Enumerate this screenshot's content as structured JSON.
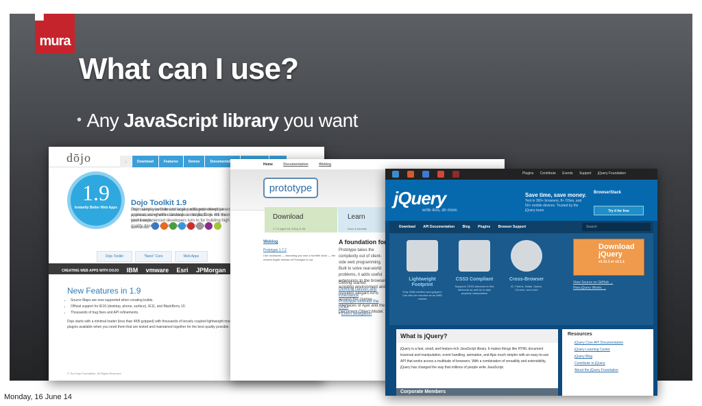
{
  "slide": {
    "logo_text": "mura",
    "title": "What can I use?",
    "bullet_prefix": "Any ",
    "bullet_bold": "JavaScript library",
    "bullet_suffix": " you want"
  },
  "footer": {
    "date": "Monday, 16 June 14"
  },
  "dojo": {
    "brand": "dōjo",
    "nav": [
      "Download",
      "Features",
      "Demos",
      "Documentation",
      "Community",
      "Blog"
    ],
    "badge_num": "1.9",
    "badge_sub": "Instantly Better Web Apps",
    "headline": "Dojo Toolkit 1.9",
    "intro": "Dojo saves you time and scales with your development process, using web standards as its platform. It's the toolkit experienced developers turn to for building high quality desktop and mobile web applications.",
    "intro2": "From simple websites to large packaged enterprise applications whether desktop or mobile, Dojo will meet your needs.",
    "supporting": "SUPPORTING",
    "tabs": [
      "Dojo Toolkit",
      "\"Nano\" Core",
      "Web Apps"
    ],
    "partners_label": "CREATING WEB APPS WITH DOJO",
    "partners": [
      "IBM",
      "vmware",
      "Esri",
      "JPMorgan",
      "cisco"
    ],
    "new_title": "New Features in 1.9",
    "features": [
      "Source Maps are now supported when creating builds.",
      "Official support for IE10 (desktop, phone, surface), IE11, and BlackBerry 10.",
      "Thousands of bug fixes and API refinements."
    ],
    "para": "Dojo starts with a minimal loader (less than 4KB gzipped) with thousands of loosely coupled lightweight modules and plugins available when you need them that are tested and maintained together for the best quality possible.",
    "foot": "© The Dojo Foundation, All Rights Reserved."
  },
  "prototype": {
    "nav": [
      "Home",
      "Documentation",
      "Weblog"
    ],
    "logo": "prototype",
    "download": "Download",
    "download_sub": "1.7.2 (April 18, 2014) & Git",
    "learn": "Learn",
    "learn_sub": "Docs & tutorials",
    "weblog": "Weblog",
    "post_title": "Prototype 1.7.2",
    "post_body": "Like clockwork — assuming you own a horrible clock — the newest bugfix release of Prototype is out.",
    "found_title": "A foundation for ambitious web user interfaces",
    "found_body": "Prototype takes the complexity out of client-side web programming. Built to solve real-world problems, it adds useful extensions to the browser scripting environment and provides elegant APIs around the clumsy interfaces of Ajax and the Document Object Model.",
    "gs_label": "Getting started:",
    "gs_links": [
      "Defining classes and inheritance",
      "Prototype extends the DOM",
      "Event delegation"
    ]
  },
  "jquery": {
    "topnav": [
      "Plugins",
      "Contribute",
      "Events",
      "Support",
      "jQuery Foundation"
    ],
    "logo": "jQuery",
    "tagline": "write less, do more.",
    "ad_title": "Save time, save money.",
    "ad_text": "Test in 300+ browsers, 8+ OSes, and 50+ mobile devices. Trusted by the jQuery team.",
    "bs": "BrowserStack",
    "try": "Try it for free",
    "menu": [
      "Download",
      "API Documentation",
      "Blog",
      "Plugins",
      "Browser Support"
    ],
    "search": "Search",
    "features": [
      {
        "title": "Lightweight Footprint",
        "sub": "Only 32kB minified and gzipped. Can also be included as an AMD module"
      },
      {
        "title": "CSS3 Compliant",
        "sub": "Supports CSS3 selectors to find elements as well as in style property manipulation"
      },
      {
        "title": "Cross-Browser",
        "sub": "IE, Firefox, Safari, Opera, Chrome, and more"
      }
    ],
    "dl_title": "Download jQuery",
    "dl_ver": "v1.11.1 or v2.1.1",
    "src1": "View Source on GitHub →",
    "src2": "How jQuery Works →",
    "what_title": "What is jQuery?",
    "what_body": "jQuery is a fast, small, and feature-rich JavaScript library. It makes things like HTML document traversal and manipulation, event handling, animation, and Ajax much simpler with an easy-to-use API that works across a multitude of browsers. With a combination of versatility and extensibility, jQuery has changed the way that millions of people write JavaScript.",
    "corp": "Corporate Members",
    "resources_title": "Resources",
    "resources": [
      "jQuery Core API Documentation",
      "jQuery Learning Center",
      "jQuery Blog",
      "Contribute to jQuery",
      "About the jQuery Foundation"
    ]
  },
  "colors": {
    "jquery_blue": "#0769ad",
    "dojo_blue": "#2fa8df",
    "mura_red": "#c5242c",
    "download_orange": "#f09a4b"
  }
}
